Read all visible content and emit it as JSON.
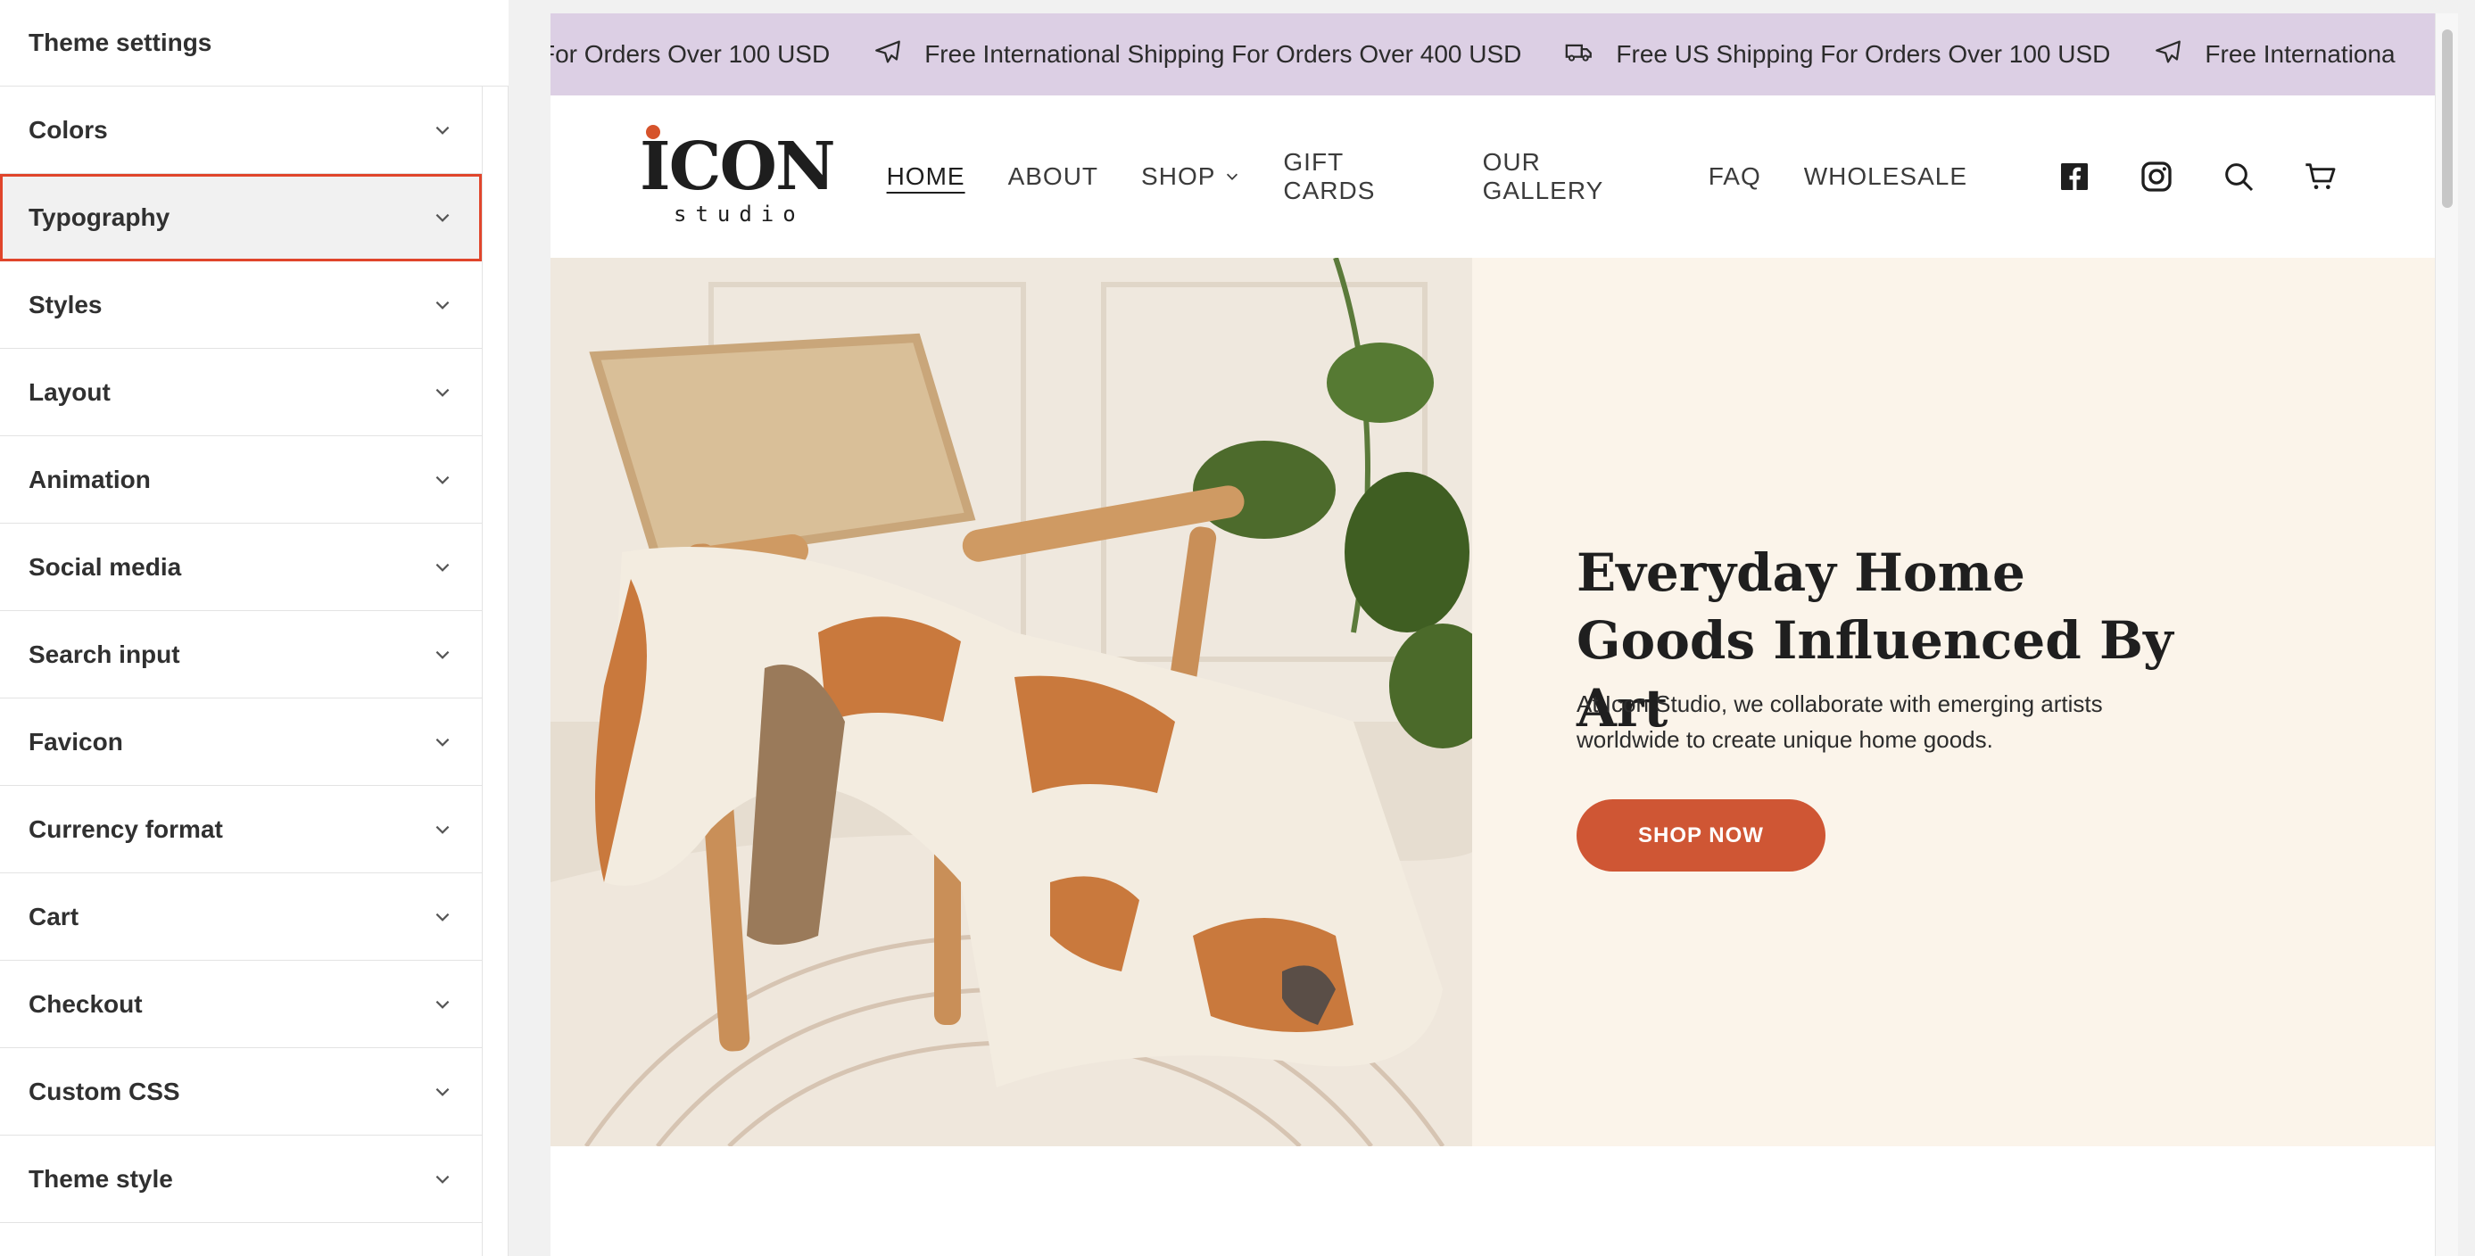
{
  "sidebar": {
    "title": "Theme settings",
    "items": [
      {
        "label": "Colors"
      },
      {
        "label": "Typography",
        "selected": true
      },
      {
        "label": "Styles"
      },
      {
        "label": "Layout"
      },
      {
        "label": "Animation"
      },
      {
        "label": "Social media"
      },
      {
        "label": "Search input"
      },
      {
        "label": "Favicon"
      },
      {
        "label": "Currency format"
      },
      {
        "label": "Cart"
      },
      {
        "label": "Checkout"
      },
      {
        "label": "Custom CSS"
      },
      {
        "label": "Theme style"
      }
    ]
  },
  "announcement": {
    "items": [
      {
        "text": "For Orders Over 100 USD",
        "icon": ""
      },
      {
        "text": "Free International Shipping For Orders Over 400 USD",
        "icon": "airplane-icon"
      },
      {
        "text": "Free US Shipping For Orders Over 100 USD",
        "icon": "truck-icon"
      },
      {
        "text": "Free Internationa",
        "icon": "airplane-icon"
      }
    ]
  },
  "header": {
    "logo_main": "ICON",
    "logo_sub": "studio",
    "nav": [
      "HOME",
      "ABOUT",
      "SHOP",
      "GIFT CARDS",
      "OUR GALLERY",
      "FAQ",
      "WHOLESALE"
    ],
    "icons": [
      "facebook-icon",
      "instagram-icon",
      "search-icon",
      "cart-icon"
    ]
  },
  "hero": {
    "heading": "Everyday Home Goods Influenced By Art",
    "text": "At Icon Studio, we collaborate with emerging artists worldwide to create unique home goods.",
    "button": "SHOP NOW"
  },
  "colors": {
    "accent": "#cf5634",
    "announcement_bg": "#dccfe4",
    "hero_bg": "#fbf4ea",
    "selected_outline": "#e0452b"
  }
}
